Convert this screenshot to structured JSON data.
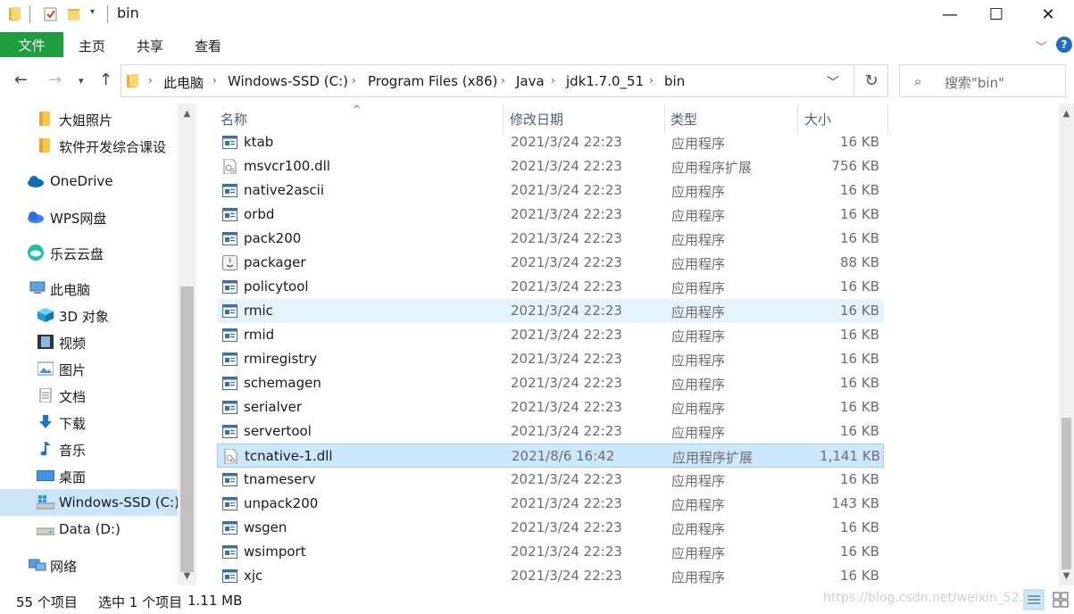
{
  "window": {
    "title": "bin",
    "controls": {
      "minimize": "—",
      "maximize": "☐",
      "close": "✕"
    }
  },
  "ribbon": {
    "file_tab": "文件",
    "tabs": [
      "主页",
      "共享",
      "查看"
    ],
    "collapse_icon": "chevron-down-icon",
    "help_icon": "?"
  },
  "address_bar": {
    "root_icon": "folder-icon",
    "crumbs": [
      "此电脑",
      "Windows-SSD (C:)",
      "Program Files (x86)",
      "Java",
      "jdk1.7.0_51",
      "bin"
    ],
    "separator": "›"
  },
  "search": {
    "placeholder": "搜索\"bin\""
  },
  "sidebar": {
    "items": [
      {
        "label": "大姐照片",
        "icon": "folder-icon"
      },
      {
        "label": "软件开发综合课设",
        "icon": "folder-icon"
      },
      {
        "label": "OneDrive",
        "icon": "onedrive-cloud-icon"
      },
      {
        "label": "WPS网盘",
        "icon": "wps-cloud-icon"
      },
      {
        "label": "乐云云盘",
        "icon": "leyun-cloud-icon"
      },
      {
        "label": "此电脑",
        "icon": "this-pc-icon"
      },
      {
        "label": "3D 对象",
        "icon": "3d-objects-icon"
      },
      {
        "label": "视频",
        "icon": "video-icon"
      },
      {
        "label": "图片",
        "icon": "pictures-icon"
      },
      {
        "label": "文档",
        "icon": "documents-icon"
      },
      {
        "label": "下载",
        "icon": "download-icon"
      },
      {
        "label": "音乐",
        "icon": "music-icon"
      },
      {
        "label": "桌面",
        "icon": "desktop-icon"
      },
      {
        "label": "Windows-SSD (C:)",
        "icon": "windows-drive-icon"
      },
      {
        "label": "Data (D:)",
        "icon": "drive-icon"
      },
      {
        "label": "网络",
        "icon": "network-icon"
      }
    ],
    "selected": "Windows-SSD (C:)"
  },
  "file_list": {
    "columns": {
      "name": "名称",
      "date": "修改日期",
      "type": "类型",
      "size": "大小"
    },
    "rows": [
      {
        "name": "ktab",
        "date": "2021/3/24 22:23",
        "type": "应用程序",
        "size": "16 KB",
        "icon": "exe-icon"
      },
      {
        "name": "msvcr100.dll",
        "date": "2021/3/24 22:23",
        "type": "应用程序扩展",
        "size": "756 KB",
        "icon": "dll-icon"
      },
      {
        "name": "native2ascii",
        "date": "2021/3/24 22:23",
        "type": "应用程序",
        "size": "16 KB",
        "icon": "exe-icon"
      },
      {
        "name": "orbd",
        "date": "2021/3/24 22:23",
        "type": "应用程序",
        "size": "16 KB",
        "icon": "exe-icon"
      },
      {
        "name": "pack200",
        "date": "2021/3/24 22:23",
        "type": "应用程序",
        "size": "16 KB",
        "icon": "exe-icon"
      },
      {
        "name": "packager",
        "date": "2021/3/24 22:23",
        "type": "应用程序",
        "size": "88 KB",
        "icon": "java-icon"
      },
      {
        "name": "policytool",
        "date": "2021/3/24 22:23",
        "type": "应用程序",
        "size": "16 KB",
        "icon": "exe-icon"
      },
      {
        "name": "rmic",
        "date": "2021/3/24 22:23",
        "type": "应用程序",
        "size": "16 KB",
        "icon": "exe-icon"
      },
      {
        "name": "rmid",
        "date": "2021/3/24 22:23",
        "type": "应用程序",
        "size": "16 KB",
        "icon": "exe-icon"
      },
      {
        "name": "rmiregistry",
        "date": "2021/3/24 22:23",
        "type": "应用程序",
        "size": "16 KB",
        "icon": "exe-icon"
      },
      {
        "name": "schemagen",
        "date": "2021/3/24 22:23",
        "type": "应用程序",
        "size": "16 KB",
        "icon": "exe-icon"
      },
      {
        "name": "serialver",
        "date": "2021/3/24 22:23",
        "type": "应用程序",
        "size": "16 KB",
        "icon": "exe-icon"
      },
      {
        "name": "servertool",
        "date": "2021/3/24 22:23",
        "type": "应用程序",
        "size": "16 KB",
        "icon": "exe-icon"
      },
      {
        "name": "tcnative-1.dll",
        "date": "2021/8/6 16:42",
        "type": "应用程序扩展",
        "size": "1,141 KB",
        "icon": "dll-icon"
      },
      {
        "name": "tnameserv",
        "date": "2021/3/24 22:23",
        "type": "应用程序",
        "size": "16 KB",
        "icon": "exe-icon"
      },
      {
        "name": "unpack200",
        "date": "2021/3/24 22:23",
        "type": "应用程序",
        "size": "143 KB",
        "icon": "exe-icon"
      },
      {
        "name": "wsgen",
        "date": "2021/3/24 22:23",
        "type": "应用程序",
        "size": "16 KB",
        "icon": "exe-icon"
      },
      {
        "name": "wsimport",
        "date": "2021/3/24 22:23",
        "type": "应用程序",
        "size": "16 KB",
        "icon": "exe-icon"
      },
      {
        "name": "xjc",
        "date": "2021/3/24 22:23",
        "type": "应用程序",
        "size": "16 KB",
        "icon": "exe-icon"
      }
    ],
    "hovered": "rmic",
    "selected": "tcnative-1.dll"
  },
  "status": {
    "item_count": "55 个项目",
    "selection": "选中 1 个项目",
    "selection_size": "1.11 MB",
    "watermark": "https://blog.csdn.net/weixin_52..."
  },
  "colors": {
    "file_tab": "#1e9e3e",
    "selected_row": "#cce8ff",
    "hover_row": "#e5f3ff",
    "sidebar_selected": "#cce4f7",
    "header_text": "#4c607a"
  }
}
